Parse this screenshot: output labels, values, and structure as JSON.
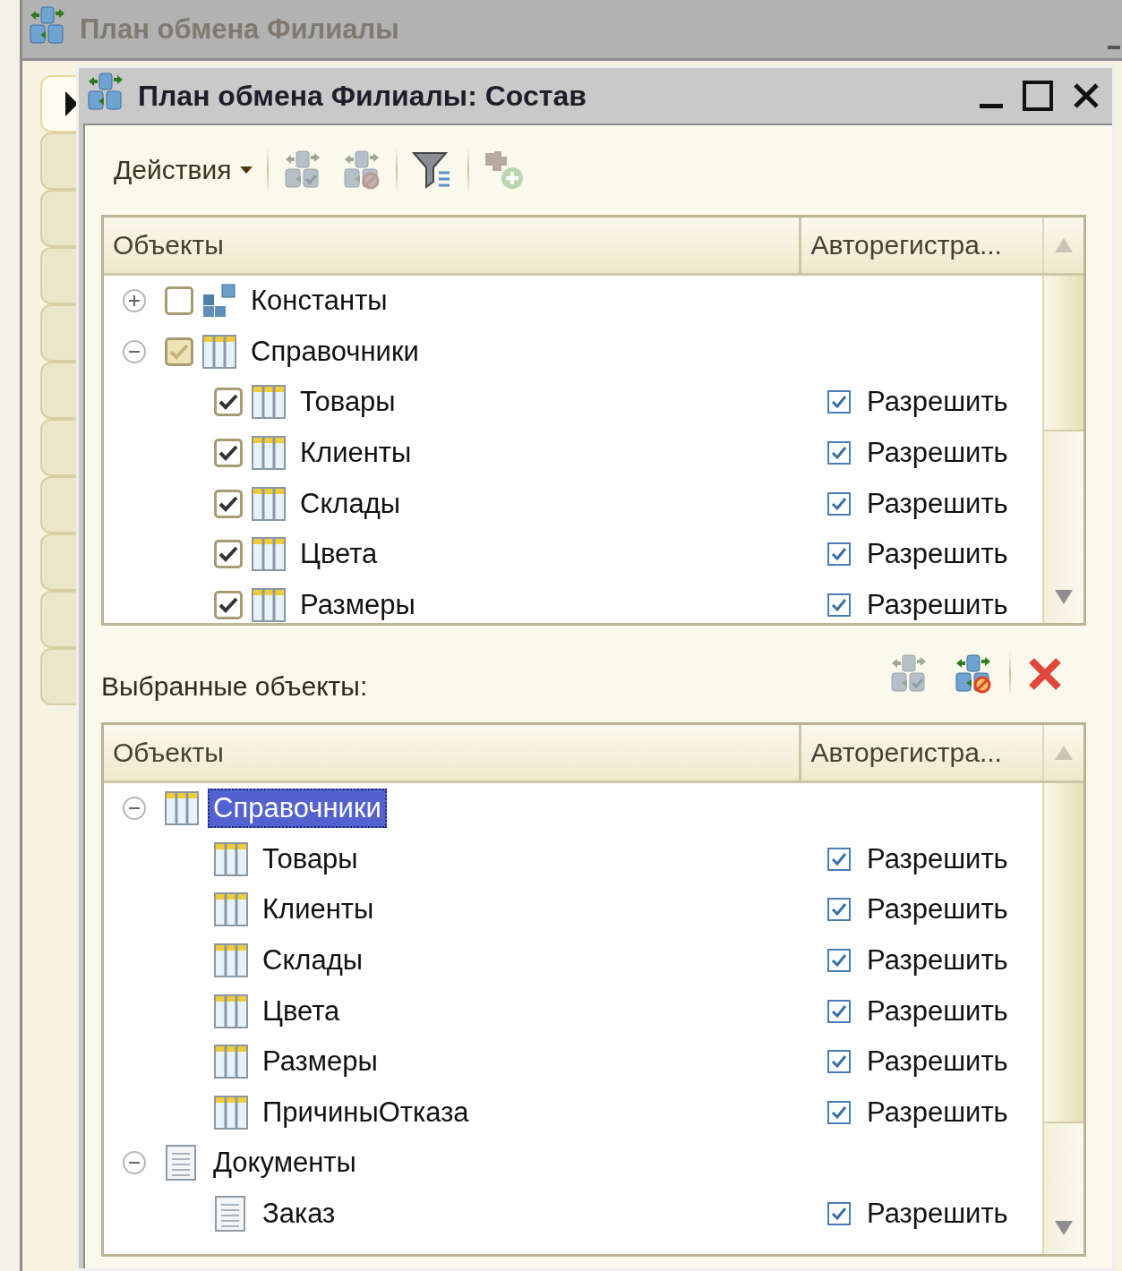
{
  "outer_window": {
    "title": "План обмена Филиалы",
    "side_tabs": [
      {
        "selected": true
      },
      {
        "selected": false
      },
      {
        "selected": false
      },
      {
        "selected": false
      },
      {
        "selected": false
      },
      {
        "selected": false
      },
      {
        "selected": false
      },
      {
        "selected": false
      },
      {
        "selected": false
      },
      {
        "selected": false
      },
      {
        "selected": false
      }
    ]
  },
  "window": {
    "title": "План обмена Филиалы: Состав"
  },
  "toolbar": {
    "actions_menu": "Действия",
    "buttons": [
      {
        "kind": "register",
        "disabled": true
      },
      {
        "kind": "unregister",
        "disabled": true
      },
      {
        "kind": "filter",
        "disabled": false
      },
      {
        "kind": "add",
        "disabled": true
      }
    ]
  },
  "objects_tree": {
    "columns": [
      "Объекты",
      "Авторегистра..."
    ],
    "rows": [
      {
        "label": "Константы",
        "kind": "constants",
        "expanded": false,
        "checked": false
      },
      {
        "label": "Справочники",
        "kind": "catalog",
        "expanded": true,
        "checked": true,
        "mixed": true,
        "children": [
          {
            "label": "Товары",
            "kind": "catalog",
            "checked": true,
            "autoregistration": {
              "checked": true,
              "label": "Разрешить"
            }
          },
          {
            "label": "Клиенты",
            "kind": "catalog",
            "checked": true,
            "autoregistration": {
              "checked": true,
              "label": "Разрешить"
            }
          },
          {
            "label": "Склады",
            "kind": "catalog",
            "checked": true,
            "autoregistration": {
              "checked": true,
              "label": "Разрешить"
            }
          },
          {
            "label": "Цвета",
            "kind": "catalog",
            "checked": true,
            "autoregistration": {
              "checked": true,
              "label": "Разрешить"
            }
          },
          {
            "label": "Размеры",
            "kind": "catalog",
            "checked": true,
            "autoregistration": {
              "checked": true,
              "label": "Разрешить"
            }
          }
        ]
      }
    ]
  },
  "selected_objects": {
    "label": "Выбранные объекты:",
    "buttons": [
      {
        "kind": "register",
        "disabled": true
      },
      {
        "kind": "unregister",
        "disabled": false
      },
      {
        "kind": "delete",
        "disabled": false
      }
    ],
    "tree": {
      "columns": [
        "Объекты",
        "Авторегистра..."
      ],
      "rows": [
        {
          "label": "Справочники",
          "kind": "catalog",
          "expanded": true,
          "selected": true,
          "children": [
            {
              "label": "Товары",
              "kind": "catalog",
              "selected": false,
              "autoregistration": {
                "checked": true,
                "label": "Разрешить"
              }
            },
            {
              "label": "Клиенты",
              "kind": "catalog",
              "selected": false,
              "autoregistration": {
                "checked": true,
                "label": "Разрешить"
              }
            },
            {
              "label": "Склады",
              "kind": "catalog",
              "selected": false,
              "autoregistration": {
                "checked": true,
                "label": "Разрешить"
              }
            },
            {
              "label": "Цвета",
              "kind": "catalog",
              "selected": false,
              "autoregistration": {
                "checked": true,
                "label": "Разрешить"
              }
            },
            {
              "label": "Размеры",
              "kind": "catalog",
              "selected": false,
              "autoregistration": {
                "checked": true,
                "label": "Разрешить"
              }
            },
            {
              "label": "ПричиныОтказа",
              "kind": "catalog",
              "selected": false,
              "autoregistration": {
                "checked": true,
                "label": "Разрешить"
              }
            }
          ]
        },
        {
          "label": "Документы",
          "kind": "document",
          "expanded": true,
          "selected": false,
          "children": [
            {
              "label": "Заказ",
              "kind": "document",
              "selected": false,
              "autoregistration": {
                "checked": true,
                "label": "Разрешить"
              }
            }
          ]
        }
      ]
    }
  }
}
